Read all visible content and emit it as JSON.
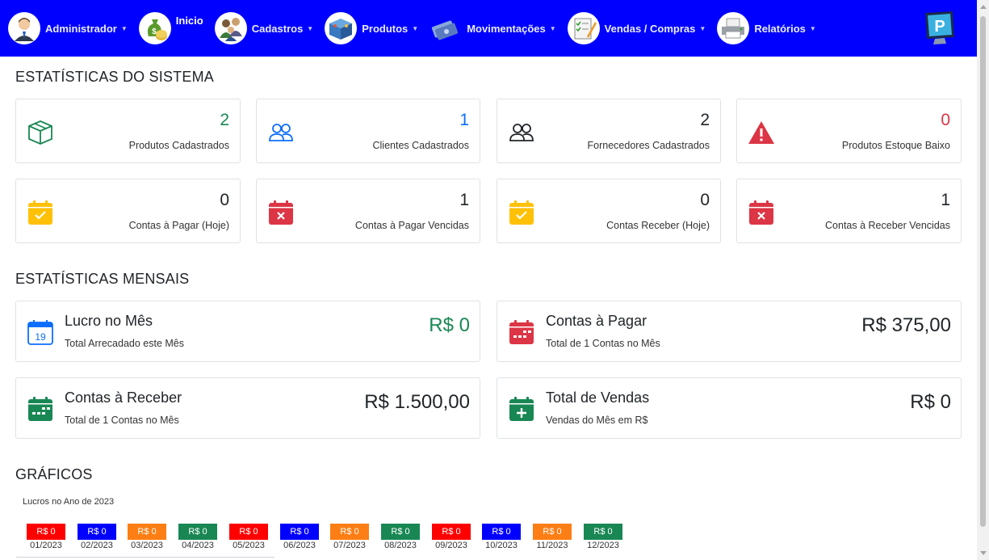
{
  "nav": {
    "items": [
      {
        "label": "Administrador",
        "icon": "user-avatar-icon",
        "dropdown": true
      },
      {
        "label": "Inicio",
        "icon": "money-bag-icon",
        "dropdown": false
      },
      {
        "label": "Cadastros",
        "icon": "people-group-icon",
        "dropdown": true
      },
      {
        "label": "Produtos",
        "icon": "product-box-icon",
        "dropdown": true
      },
      {
        "label": "Movimentações",
        "icon": "money-notes-icon",
        "dropdown": true
      },
      {
        "label": "Vendas / Compras",
        "icon": "checklist-pen-icon",
        "dropdown": true
      },
      {
        "label": "Relatórios",
        "icon": "printer-icon",
        "dropdown": true
      }
    ],
    "brand_icon": "monitor-logo-icon",
    "background": "#0000ff"
  },
  "stats": {
    "title": "ESTATÍSTICAS DO SISTEMA",
    "cards": [
      {
        "value": "2",
        "label": "Produtos Cadastrados",
        "icon": "box-icon",
        "color": "#198754"
      },
      {
        "value": "1",
        "label": "Clientes Cadastrados",
        "icon": "people-icon",
        "color": "#0d6efd"
      },
      {
        "value": "2",
        "label": "Fornecedores Cadastrados",
        "icon": "people-icon",
        "color": "#212529"
      },
      {
        "value": "0",
        "label": "Produtos Estoque Baixo",
        "icon": "warning-icon",
        "color": "#dc3545"
      },
      {
        "value": "0",
        "label": "Contas à Pagar (Hoje)",
        "icon": "calendar-check-icon",
        "color": "#212529"
      },
      {
        "value": "1",
        "label": "Contas à Pagar Vencidas",
        "icon": "calendar-x-icon",
        "color": "#212529"
      },
      {
        "value": "0",
        "label": "Contas Receber (Hoje)",
        "icon": "calendar-check-icon",
        "color": "#212529"
      },
      {
        "value": "1",
        "label": "Contas à Receber Vencidas",
        "icon": "calendar-x-icon",
        "color": "#212529"
      }
    ]
  },
  "monthly": {
    "title": "ESTATÍSTICAS MENSAIS",
    "cards": [
      {
        "title": "Lucro no Mês",
        "sub": "Total Arrecadado este Mês",
        "value": "R$ 0",
        "icon": "calendar-day-icon",
        "color": "#198754"
      },
      {
        "title": "Contas à Pagar",
        "sub": "Total de 1 Contas no Mês",
        "value": "R$ 375,00",
        "icon": "calendar-week-icon",
        "color": "#212529"
      },
      {
        "title": "Contas à Receber",
        "sub": "Total de 1 Contas no Mês",
        "value": "R$ 1.500,00",
        "icon": "calendar-week-icon",
        "color": "#212529"
      },
      {
        "title": "Total de Vendas",
        "sub": "Vendas do Mês em R$",
        "value": "R$ 0",
        "icon": "calendar-plus-icon",
        "color": "#212529"
      }
    ]
  },
  "charts": {
    "title": "GRÁFICOS"
  },
  "chart_data": {
    "type": "bar",
    "title": "Lucros no Ano de 2023",
    "categories": [
      "01/2023",
      "02/2023",
      "03/2023",
      "04/2023",
      "05/2023",
      "06/2023",
      "07/2023",
      "08/2023",
      "09/2023",
      "10/2023",
      "11/2023",
      "12/2023"
    ],
    "values": [
      0,
      0,
      0,
      0,
      0,
      0,
      0,
      0,
      0,
      0,
      0,
      0
    ],
    "value_labels": [
      "R$ 0",
      "R$ 0",
      "R$ 0",
      "R$ 0",
      "R$ 0",
      "R$ 0",
      "R$ 0",
      "R$ 0",
      "R$ 0",
      "R$ 0",
      "R$ 0",
      "R$ 0"
    ],
    "bar_colors": [
      "#ff0000",
      "#0000ff",
      "#fd7e14",
      "#198754",
      "#ff0000",
      "#0000ff",
      "#fd7e14",
      "#198754",
      "#ff0000",
      "#0000ff",
      "#fd7e14",
      "#198754"
    ]
  }
}
